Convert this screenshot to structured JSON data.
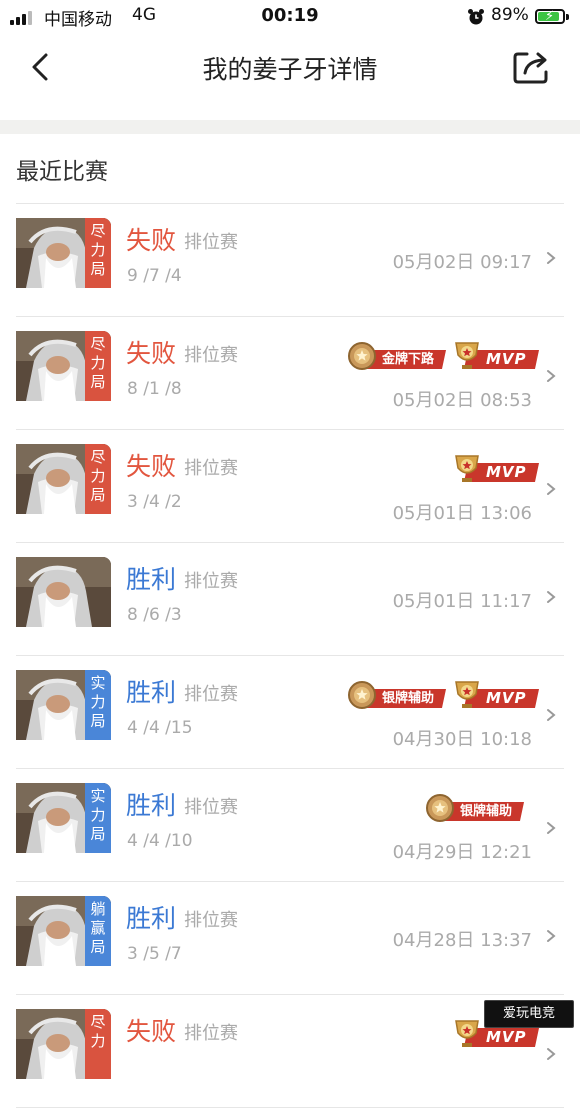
{
  "status_bar": {
    "carrier": "中国移动",
    "network": "4G",
    "time": "00:19",
    "battery_percent": "89%",
    "battery_level": 0.89,
    "icons": [
      "signal-icon",
      "alarm-icon",
      "battery-charging-icon"
    ]
  },
  "nav": {
    "title": "我的姜子牙详情",
    "back_icon": "chevron-left-icon",
    "share_icon": "share-icon"
  },
  "section": {
    "title": "最近比赛"
  },
  "matches": [
    {
      "result": "失败",
      "result_type": "lose",
      "game_type": "排位赛",
      "kda": "9 /7 /4",
      "time": "05月02日 09:17",
      "mode_tag": [
        "尽",
        "力",
        "局"
      ],
      "tag_color": "red",
      "badges": []
    },
    {
      "result": "失败",
      "result_type": "lose",
      "game_type": "排位赛",
      "kda": "8 /1 /8",
      "time": "05月02日 08:53",
      "mode_tag": [
        "尽",
        "力",
        "局"
      ],
      "tag_color": "red",
      "badges": [
        "金牌下路",
        "MVP"
      ]
    },
    {
      "result": "失败",
      "result_type": "lose",
      "game_type": "排位赛",
      "kda": "3 /4 /2",
      "time": "05月01日 13:06",
      "mode_tag": [
        "尽",
        "力",
        "局"
      ],
      "tag_color": "red",
      "badges": [
        "MVP"
      ]
    },
    {
      "result": "胜利",
      "result_type": "win",
      "game_type": "排位赛",
      "kda": "8 /6 /3",
      "time": "05月01日 11:17",
      "mode_tag": [],
      "tag_color": "none",
      "badges": []
    },
    {
      "result": "胜利",
      "result_type": "win",
      "game_type": "排位赛",
      "kda": "4 /4 /15",
      "time": "04月30日 10:18",
      "mode_tag": [
        "实",
        "力",
        "局"
      ],
      "tag_color": "blue",
      "badges": [
        "银牌辅助",
        "MVP"
      ]
    },
    {
      "result": "胜利",
      "result_type": "win",
      "game_type": "排位赛",
      "kda": "4 /4 /10",
      "time": "04月29日 12:21",
      "mode_tag": [
        "实",
        "力",
        "局"
      ],
      "tag_color": "blue",
      "badges": [
        "银牌辅助"
      ]
    },
    {
      "result": "胜利",
      "result_type": "win",
      "game_type": "排位赛",
      "kda": "3 /5 /7",
      "time": "04月28日 13:37",
      "mode_tag": [
        "躺",
        "赢",
        "局"
      ],
      "tag_color": "blue",
      "badges": []
    },
    {
      "result": "失败",
      "result_type": "lose",
      "game_type": "排位赛",
      "kda": "",
      "time": "",
      "mode_tag": [
        "尽",
        "力"
      ],
      "tag_color": "red",
      "badges": [
        "MVP"
      ]
    }
  ],
  "watermark": "爱玩电竞",
  "colors": {
    "lose": "#e2563f",
    "win": "#3b79d4",
    "tag_red": "#d9533f",
    "tag_blue": "#4a86d8",
    "ribbon": "#c9362b",
    "medal": "#d9a64a"
  }
}
